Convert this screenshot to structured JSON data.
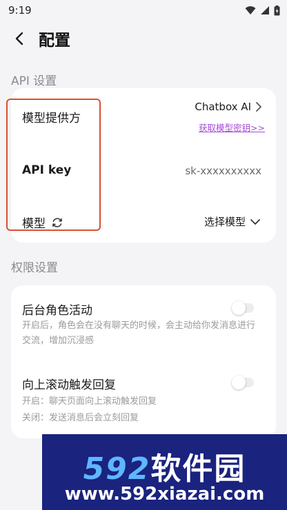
{
  "status_bar": {
    "time": "9:19"
  },
  "header": {
    "title": "配置"
  },
  "api_section": {
    "label": "API 设置",
    "provider": {
      "label": "模型提供方",
      "value": "Chatbox AI",
      "link": "获取模型密钥>>"
    },
    "api_key": {
      "label": "API key",
      "value": "sk-xxxxxxxxxx"
    },
    "model": {
      "label": "模型",
      "value": "选择模型"
    }
  },
  "permission_section": {
    "label": "权限设置",
    "background_activity": {
      "title": "后台角色活动",
      "desc": "开启后，角色会在没有聊天的时候，会主动给你发消息进行交流，增加沉浸感",
      "enabled": false
    },
    "scroll_reply": {
      "title": "向上滚动触发回复",
      "desc_on": "开启：聊天页面向上滚动触发回复",
      "desc_off": "关闭：发送消息后会立刻回复",
      "enabled": false
    }
  },
  "watermark": {
    "brand_num": "592",
    "brand_text": "软件园",
    "url": "www.592xiazai.com"
  },
  "colors": {
    "highlight": "#d9502f",
    "link": "#a64bd6",
    "watermark_bg": "#1a237e"
  }
}
